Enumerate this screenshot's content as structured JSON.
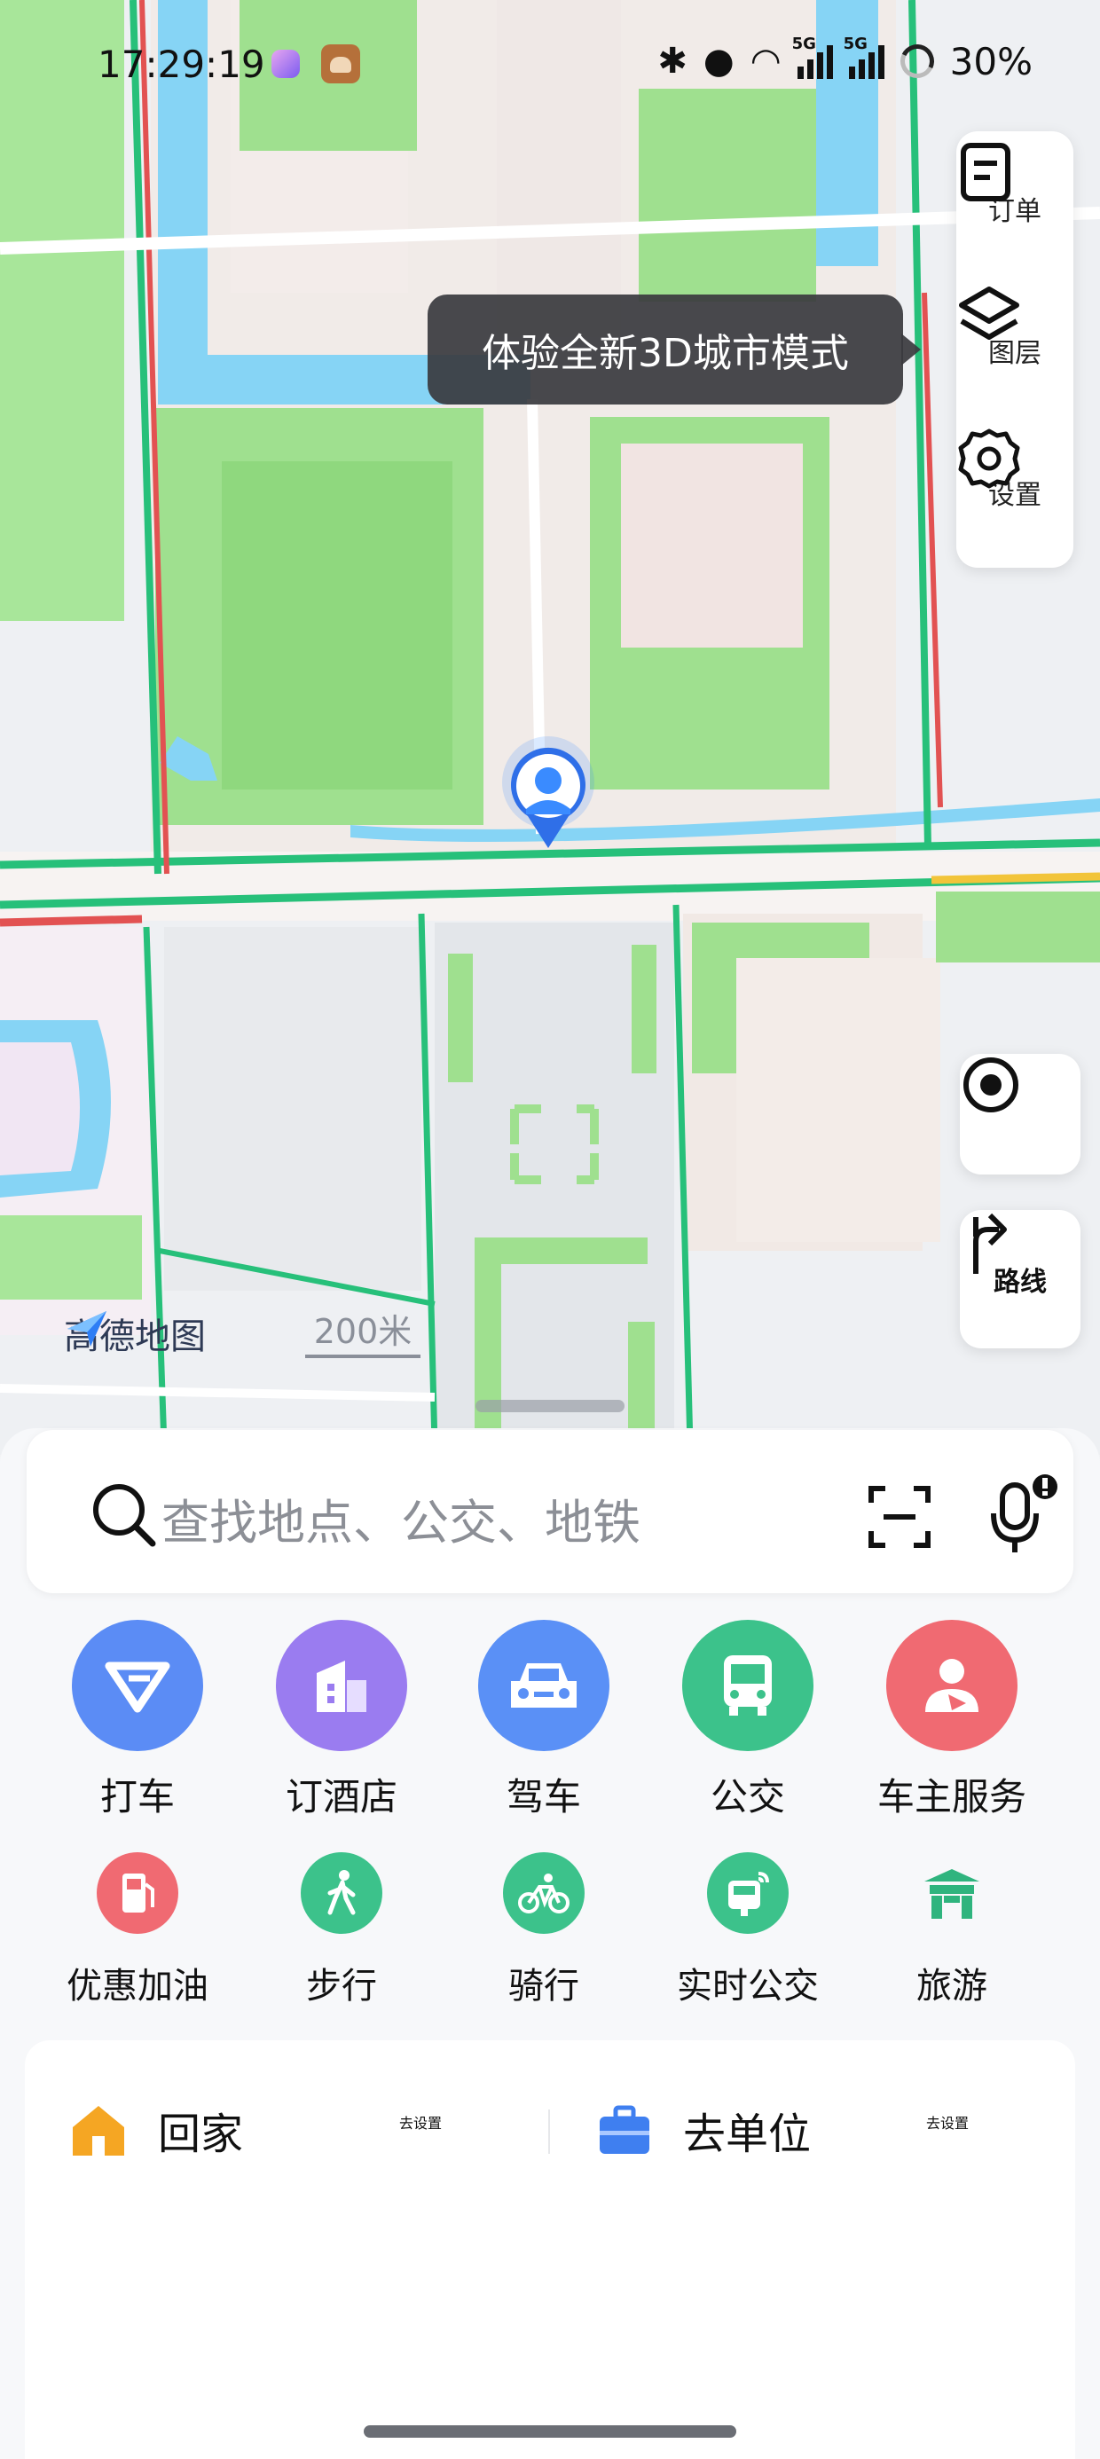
{
  "status_bar": {
    "time": "17:29:19",
    "battery": "30%",
    "signal1_label": "5G",
    "signal2_label": "5G"
  },
  "map": {
    "tooltip": "体验全新3D城市模式",
    "controls": {
      "orders": "订单",
      "layers": "图层",
      "settings": "设置"
    },
    "route_label": "路线",
    "brand": "高德地图",
    "scale": "200米"
  },
  "search": {
    "placeholder": "查找地点、公交、地铁"
  },
  "services_primary": [
    {
      "label": "打车",
      "icon": "taxi-icon",
      "color": "#5b8cf5"
    },
    {
      "label": "订酒店",
      "icon": "hotel-icon",
      "color": "#9a7cf0"
    },
    {
      "label": "驾车",
      "icon": "car-icon",
      "color": "#5a90f6"
    },
    {
      "label": "公交",
      "icon": "bus-icon",
      "color": "#3cc28b"
    },
    {
      "label": "车主服务",
      "icon": "car-owner-icon",
      "color": "#f06a72"
    }
  ],
  "services_secondary": [
    {
      "label": "优惠加油",
      "icon": "fuel-icon",
      "color": "#f06a72"
    },
    {
      "label": "步行",
      "icon": "walk-icon",
      "color": "#3cc28b"
    },
    {
      "label": "骑行",
      "icon": "bike-icon",
      "color": "#3cc28b"
    },
    {
      "label": "实时公交",
      "icon": "realtime-bus-icon",
      "color": "#3cc28b"
    },
    {
      "label": "旅游",
      "icon": "travel-icon",
      "color": "#2fb47e"
    }
  ],
  "favorites": {
    "home": {
      "label": "回家",
      "action": "去设置"
    },
    "work": {
      "label": "去单位",
      "action": "去设置"
    }
  }
}
